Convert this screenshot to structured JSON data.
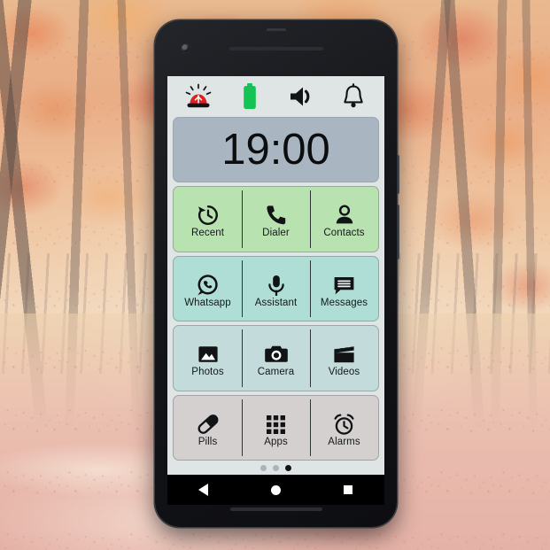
{
  "background": {
    "description": "autumn forest path with orange and red foliage"
  },
  "device": {
    "name": "smartphone",
    "frame_color": "#15161a",
    "screen_bg": "#dfe4e4"
  },
  "statusbar": {
    "icons": [
      {
        "name": "emergency-siren-icon",
        "label": "Emergency",
        "color": "#e02020"
      },
      {
        "name": "battery-icon",
        "label": "Battery full",
        "color": "#13c353"
      },
      {
        "name": "volume-icon",
        "label": "Volume",
        "color": "#111315"
      },
      {
        "name": "bell-icon",
        "label": "Notifications",
        "color": "#111315"
      }
    ]
  },
  "clock": {
    "time": "19:00",
    "bg_color": "#a9b6c2"
  },
  "rows": [
    {
      "name": "row-communication",
      "bg_color": "#b9e2b1",
      "tiles": [
        {
          "icon": "history-icon",
          "label": "Recent"
        },
        {
          "icon": "phone-icon",
          "label": "Dialer"
        },
        {
          "icon": "person-icon",
          "label": "Contacts"
        }
      ]
    },
    {
      "name": "row-messaging",
      "bg_color": "#aeded5",
      "tiles": [
        {
          "icon": "whatsapp-icon",
          "label": "Whatsapp"
        },
        {
          "icon": "microphone-icon",
          "label": "Assistant"
        },
        {
          "icon": "message-icon",
          "label": "Messages"
        }
      ]
    },
    {
      "name": "row-media",
      "bg_color": "#c3dbdb",
      "tiles": [
        {
          "icon": "photo-icon",
          "label": "Photos"
        },
        {
          "icon": "camera-icon",
          "label": "Camera"
        },
        {
          "icon": "video-clapper-icon",
          "label": "Videos"
        }
      ]
    },
    {
      "name": "row-utilities",
      "bg_color": "#d4d0cf",
      "tiles": [
        {
          "icon": "pill-icon",
          "label": "Pills"
        },
        {
          "icon": "grid-apps-icon",
          "label": "Apps"
        },
        {
          "icon": "alarm-clock-icon",
          "label": "Alarms"
        }
      ]
    }
  ],
  "pager": {
    "total": 3,
    "active_index": 3
  },
  "navbar": {
    "buttons": [
      {
        "name": "back-button",
        "label": "Back"
      },
      {
        "name": "home-button",
        "label": "Home"
      },
      {
        "name": "recents-button",
        "label": "Recent apps"
      }
    ]
  }
}
